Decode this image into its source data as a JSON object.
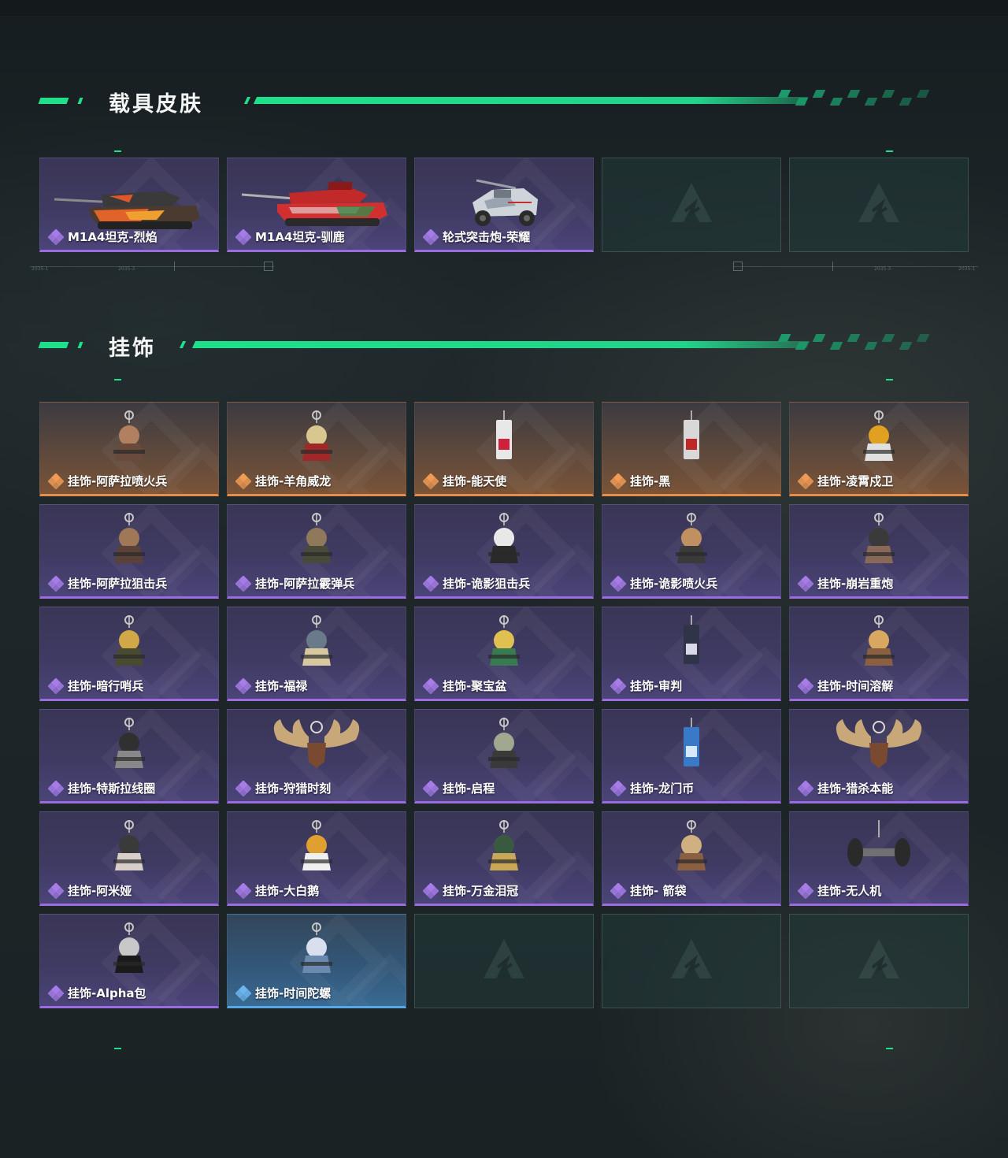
{
  "sections": [
    {
      "title": "载具皮肤",
      "items": [
        {
          "label": "M1A4坦克-烈焰",
          "rarity": "purple",
          "icon": "tank-flame-icon"
        },
        {
          "label": "M1A4坦克-驯鹿",
          "rarity": "purple",
          "icon": "tank-reindeer-icon"
        },
        {
          "label": "轮式突击炮-荣耀",
          "rarity": "purple",
          "icon": "wheeled-assault-gun-icon"
        },
        {
          "empty": true
        },
        {
          "empty": true
        }
      ]
    },
    {
      "title": "挂饰",
      "items": [
        {
          "label": "挂饰-阿萨拉喷火兵",
          "rarity": "orange",
          "icon": "flamethrower-soldier-charm-icon"
        },
        {
          "label": "挂饰-羊角威龙",
          "rarity": "orange",
          "icon": "ram-horn-charm-icon"
        },
        {
          "label": "挂饰-能天使",
          "rarity": "orange",
          "icon": "angel-card-charm-icon"
        },
        {
          "label": "挂饰-黑",
          "rarity": "orange",
          "icon": "black-card-charm-icon"
        },
        {
          "label": "挂饰-凌霄戍卫",
          "rarity": "orange",
          "icon": "guard-charm-icon"
        },
        {
          "label": "挂饰-阿萨拉狙击兵",
          "rarity": "purple",
          "icon": "sniper-charm-icon"
        },
        {
          "label": "挂饰-阿萨拉霰弹兵",
          "rarity": "purple",
          "icon": "shotgunner-charm-icon"
        },
        {
          "label": "挂饰-诡影狙击兵",
          "rarity": "purple",
          "icon": "shadow-sniper-charm-icon"
        },
        {
          "label": "挂饰-诡影喷火兵",
          "rarity": "purple",
          "icon": "shadow-flamer-charm-icon"
        },
        {
          "label": "挂饰-崩岩重炮",
          "rarity": "purple",
          "icon": "heavy-gunner-charm-icon"
        },
        {
          "label": "挂饰-暗行哨兵",
          "rarity": "purple",
          "icon": "sentry-charm-icon"
        },
        {
          "label": "挂饰-福禄",
          "rarity": "purple",
          "icon": "gourd-charm-icon"
        },
        {
          "label": "挂饰-聚宝盆",
          "rarity": "purple",
          "icon": "treasure-bowl-charm-icon"
        },
        {
          "label": "挂饰-审判",
          "rarity": "purple",
          "icon": "judgement-card-charm-icon"
        },
        {
          "label": "挂饰-时间溶解",
          "rarity": "purple",
          "icon": "melting-clock-charm-icon"
        },
        {
          "label": "挂饰-特斯拉线圈",
          "rarity": "purple",
          "icon": "tesla-coil-charm-icon"
        },
        {
          "label": "挂饰-狩猎时刻",
          "rarity": "purple",
          "icon": "antler-charm-icon"
        },
        {
          "label": "挂饰-启程",
          "rarity": "purple",
          "icon": "medallion-charm-icon"
        },
        {
          "label": "挂饰-龙门币",
          "rarity": "purple",
          "icon": "coin-tag-charm-icon"
        },
        {
          "label": "挂饰-猎杀本能",
          "rarity": "purple",
          "icon": "antler-trophy-charm-icon"
        },
        {
          "label": "挂饰-阿米娅",
          "rarity": "purple",
          "icon": "bunny-charm-icon"
        },
        {
          "label": "挂饰-大白鹅",
          "rarity": "purple",
          "icon": "goose-charm-icon"
        },
        {
          "label": "挂饰-万金泪冠",
          "rarity": "purple",
          "icon": "crown-charm-icon"
        },
        {
          "label": "挂饰- 箭袋",
          "rarity": "purple",
          "icon": "quiver-charm-icon"
        },
        {
          "label": "挂饰-无人机",
          "rarity": "purple",
          "icon": "drone-charm-icon"
        },
        {
          "label": "挂饰-Alpha包",
          "rarity": "purple",
          "icon": "alpha-bag-charm-icon"
        },
        {
          "label": "挂饰-时间陀螺",
          "rarity": "blue",
          "icon": "spinning-top-charm-icon"
        },
        {
          "empty": true
        },
        {
          "empty": true
        },
        {
          "empty": true
        }
      ]
    }
  ],
  "colors": {
    "accent": "#1ee08a",
    "purple": "#9a6ce0",
    "orange": "#e88c46",
    "blue": "#58a8e8"
  },
  "deco_labels": [
    "2035-1",
    "2035-3",
    "2035-3",
    "2035-1"
  ]
}
